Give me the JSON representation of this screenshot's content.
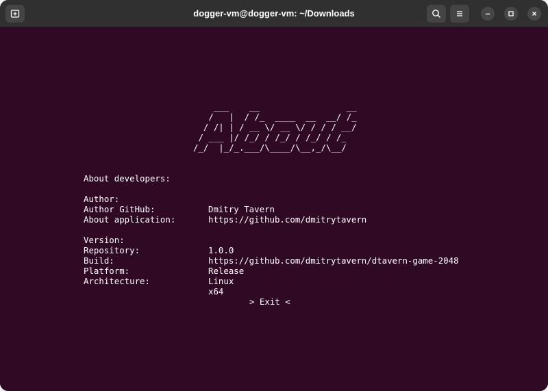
{
  "window": {
    "title": "dogger-vm@dogger-vm: ~/Downloads",
    "colors": {
      "terminal_bg": "#300a24",
      "titlebar_bg": "#303030",
      "text": "#ffffff"
    },
    "icons": [
      "new-tab-icon",
      "search-icon",
      "menu-icon",
      "minimize-icon",
      "maximize-icon",
      "close-icon"
    ]
  },
  "banner": {
    "ascii_lines": [
      "    ___    __                 __ ",
      "   /   |  / /_  ____  __  __/ /_",
      "  / /| | / __ \\/ __ \\/ / / / __/",
      " / ___ |/ /_/ / /_/ / /_/ / /_  ",
      "/_/  |_/_.___/\\____/\\__,_/\\__/  "
    ]
  },
  "developers": {
    "heading": "About developers:",
    "rows": [
      {
        "key": "Author:",
        "value": "Dmitry Tavern"
      },
      {
        "key": "Author GitHub:",
        "value": "https://github.com/dmitrytavern"
      }
    ]
  },
  "application": {
    "heading": "About application:",
    "rows": [
      {
        "key": "Version:",
        "value": "1.0.0"
      },
      {
        "key": "Repository:",
        "value": "https://github.com/dmitrytavern/dtavern-game-2048"
      },
      {
        "key": "Build:",
        "value": "Release"
      },
      {
        "key": "Platform:",
        "value": "Linux"
      },
      {
        "key": "Architecture:",
        "value": "x64"
      }
    ]
  },
  "exit_label": "> Exit <"
}
